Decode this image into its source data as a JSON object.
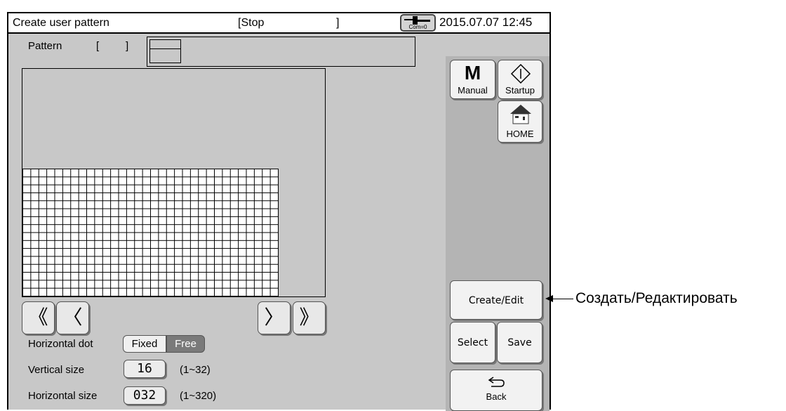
{
  "header": {
    "title": "Create user pattern",
    "status": "[Stop",
    "status_close": "]",
    "com_label": "Com=0",
    "datetime": "2015.07.07 12:45"
  },
  "pattern": {
    "label": "Pattern",
    "bracket_open": "[",
    "bracket_close": "]"
  },
  "nav": {
    "first": "《",
    "prev": "〈",
    "next": "〉",
    "last": "》"
  },
  "settings": {
    "horizontal_dot_label": "Horizontal dot",
    "fixed_label": "Fixed",
    "free_label": "Free",
    "selected_mode": "Free",
    "vertical_size_label": "Vertical size",
    "vertical_size_value": "16",
    "vertical_range": "(1~32)",
    "horizontal_size_label": "Horizontal size",
    "horizontal_size_value": "032",
    "horizontal_range": "(1~320)"
  },
  "side_buttons": {
    "manual_letter": "M",
    "manual_label": "Manual",
    "startup_label": "Startup",
    "home_label": "HOME",
    "create_edit_label": "Create/Edit",
    "select_label": "Select",
    "save_label": "Save",
    "back_label": "Back"
  },
  "annotation": {
    "create_edit_translation": "Создать/Редактировать"
  },
  "grid": {
    "columns": 32,
    "rows": 16
  },
  "colors": {
    "screen_bg": "#c8c8c8",
    "side_panel_bg": "#b4b4b4",
    "selected_segment": "#7a7a7a"
  }
}
